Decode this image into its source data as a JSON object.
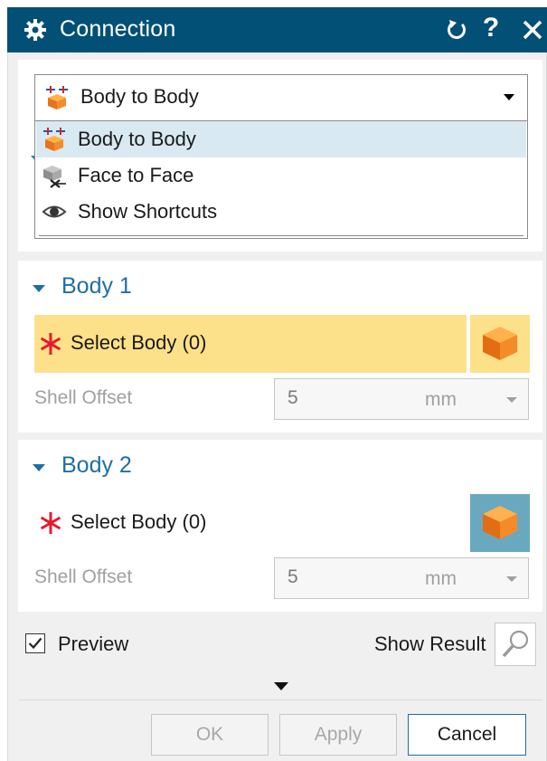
{
  "window": {
    "title": "Connection",
    "icons": [
      "gear-icon",
      "reset-icon",
      "help-icon",
      "close-icon"
    ],
    "help_glyph": "?"
  },
  "type_selector": {
    "selected": "Body to Body",
    "options": [
      {
        "label": "Body to Body",
        "icon": "body-to-body-icon",
        "highlighted": true
      },
      {
        "label": "Face to Face",
        "icon": "face-to-face-icon",
        "highlighted": false
      },
      {
        "label": "Show Shortcuts",
        "icon": "eye-icon",
        "highlighted": false
      }
    ]
  },
  "body1": {
    "header": "Body 1",
    "select_label": "Select Body (0)",
    "shell_offset_label": "Shell Offset",
    "shell_offset_value": "5",
    "shell_offset_unit": "mm"
  },
  "body2": {
    "header": "Body 2",
    "select_label": "Select Body (0)",
    "shell_offset_label": "Shell Offset",
    "shell_offset_value": "5",
    "shell_offset_unit": "mm"
  },
  "footer": {
    "preview_label": "Preview",
    "preview_checked": true,
    "show_result_label": "Show Result",
    "ok_label": "OK",
    "apply_label": "Apply",
    "cancel_label": "Cancel"
  },
  "colors": {
    "titlebar": "#025076",
    "section_header": "#1e6fa5",
    "active_selection": "#fde08a",
    "cube_button_blue": "#6aa8c0",
    "required_star": "#e8192c",
    "dropdown_highlight": "#d9e9f1"
  }
}
